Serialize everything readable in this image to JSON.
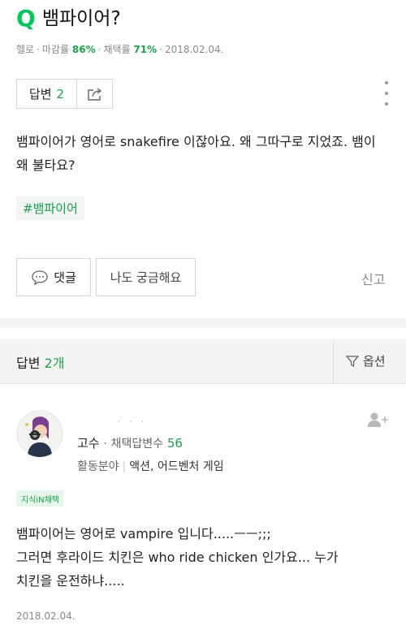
{
  "question": {
    "icon": "Q",
    "title": "뱀파이어?",
    "meta": {
      "author": "헬로",
      "deadline_label": "마감률",
      "deadline_value": "86%",
      "adopt_label": "채택률",
      "adopt_value": "71%",
      "date": "2018.02.04."
    },
    "answer_button": {
      "label": "답변",
      "count": "2"
    },
    "body": "뱀파이어가 영어로 snakefire 이잖아요. 왜 그따구로 지었죠. 뱀이 왜 불타요?",
    "tag": "#뱀파이어",
    "comment_button": "댓글",
    "curious_button": "나도 궁금해요",
    "report": "신고"
  },
  "answers_bar": {
    "label": "답변",
    "count": "2개",
    "options": "옵션"
  },
  "answer": {
    "username": "고수",
    "adopted_label": "채택답변수",
    "adopted_count": "56",
    "field_label": "활동분야",
    "field_value": "액션, 어드벤처 게임",
    "badge": "지식iN채택",
    "lines": [
      "뱀파이어는 영어로 vampire 입니다.....ㅡㅡ;;;",
      "그러면 후라이드 치킨은 who ride chicken 인가요... 누가",
      "치킨을 운전하냐....."
    ],
    "date": "2018.02.04."
  },
  "colors": {
    "accent_green": "#19a34a",
    "brand_green": "#03c75a"
  },
  "icons": [
    "share-icon",
    "more-vert-icon",
    "comment-bubble-icon",
    "filter-icon",
    "add-user-icon",
    "avatar-image"
  ]
}
